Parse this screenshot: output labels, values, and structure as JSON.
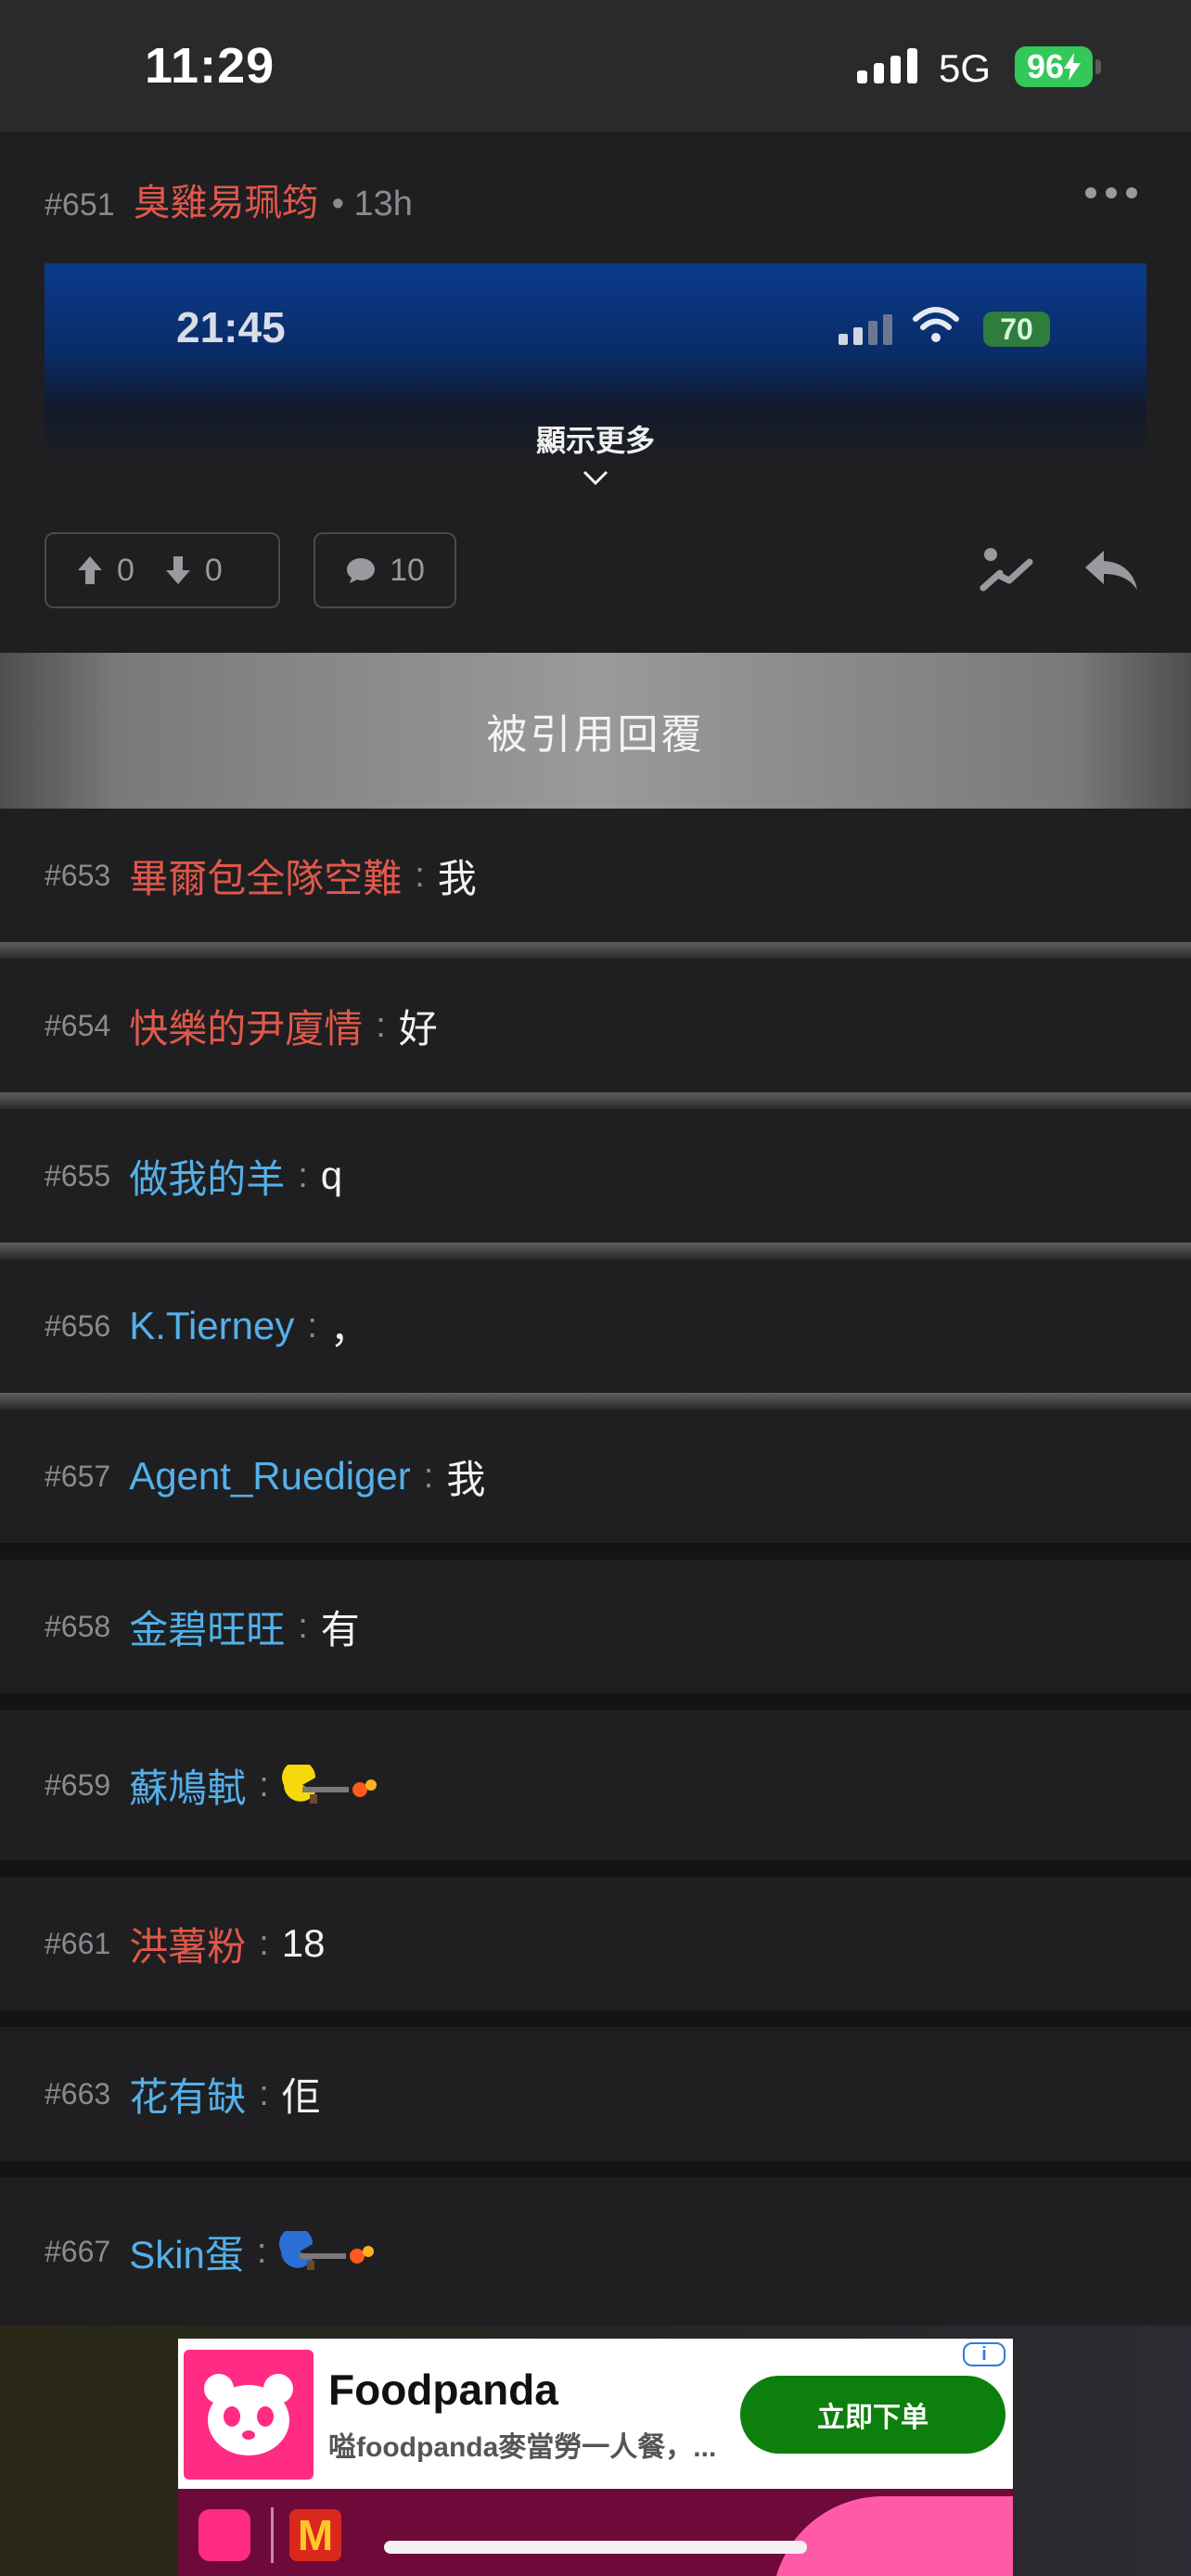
{
  "status_bar": {
    "time": "11:29",
    "network": "5G",
    "battery": "96"
  },
  "post": {
    "floor": "#651",
    "author": "臭雞易珮筠",
    "time": "• 13h",
    "preview": {
      "time": "21:45",
      "battery": "70"
    },
    "show_more": "顯示更多",
    "upvotes": "0",
    "downvotes": "0",
    "comments": "10"
  },
  "banner": {
    "title": "被引用回覆"
  },
  "replies": [
    {
      "floor": "#653",
      "author": "畢爾包全隊空難",
      "author_color": "#e0584a",
      "sep": ":",
      "text": "我"
    },
    {
      "floor": "#654",
      "author": "快樂的尹廈情",
      "author_color": "#e0584a",
      "sep": ":",
      "text": "好"
    },
    {
      "floor": "#655",
      "author": "做我的羊",
      "author_color": "#54b0ea",
      "sep": ":",
      "text": "q"
    },
    {
      "floor": "#656",
      "author": "K.Tierney",
      "author_color": "#54b0ea",
      "sep": ":",
      "text": "，"
    },
    {
      "floor": "#657",
      "author": "Agent_Ruediger",
      "author_color": "#54b0ea",
      "sep": ":",
      "text": "我"
    },
    {
      "floor": "#658",
      "author": "金碧旺旺",
      "author_color": "#54b0ea",
      "sep": ":",
      "text": "有"
    },
    {
      "floor": "#659",
      "author": "蘇鳩軾",
      "author_color": "#54b0ea",
      "sep": ":",
      "sticker": "yellow-shooter-sticker"
    },
    {
      "floor": "#661",
      "author": "洪薯粉",
      "author_color": "#e0584a",
      "sep": ":",
      "text": "18"
    },
    {
      "floor": "#663",
      "author": "花有缺",
      "author_color": "#54b0ea",
      "sep": ":",
      "text": "佢"
    },
    {
      "floor": "#667",
      "author": "Skin蛋",
      "author_color": "#54b0ea",
      "sep": ":",
      "sticker": "blue-shooter-sticker"
    }
  ],
  "ad": {
    "title": "Foodpanda",
    "description": "嗌foodpanda麥當勞一人餐，...",
    "cta": "立即下单",
    "info": "i",
    "mcd_logo": "M",
    "brand_color": "#ff2b85",
    "cta_color": "#0d7f0d"
  },
  "colors": {
    "author_red": "#e0584a",
    "author_blue": "#54b0ea",
    "background": "#1a1a1c"
  }
}
